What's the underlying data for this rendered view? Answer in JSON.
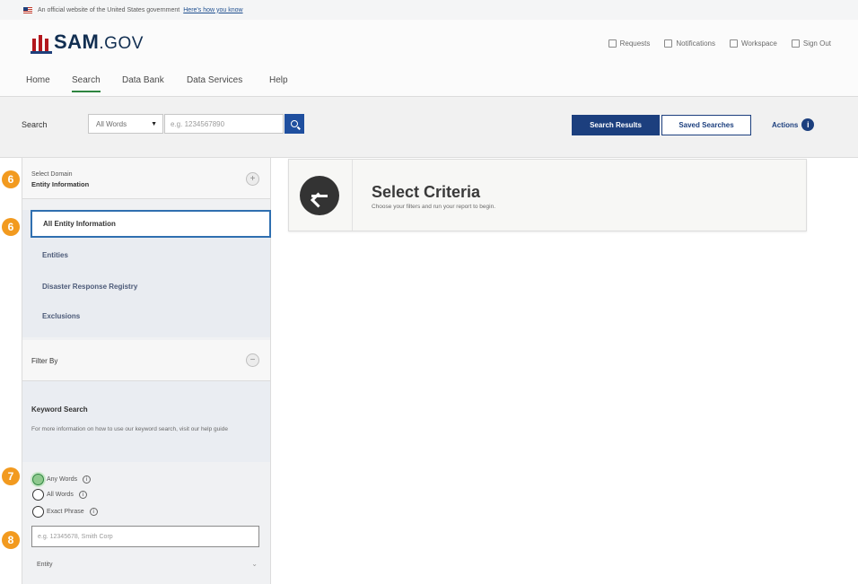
{
  "gov_banner": {
    "text": "An official website of the United States government",
    "link": "Here's how you know"
  },
  "logo": {
    "brand": "SAM",
    "suffix": ".GOV"
  },
  "header_links": [
    "Requests",
    "Notifications",
    "Workspace",
    "Sign Out"
  ],
  "nav": [
    "Home",
    "Search",
    "Data Bank",
    "Data Services",
    "Help"
  ],
  "nav_active": "Search",
  "search": {
    "label": "Search",
    "scope_value": "All Words",
    "placeholder": "e.g. 1234567890",
    "results_button": "Search Results",
    "saved_button": "Saved Searches",
    "actions_label": "Actions"
  },
  "sidebar": {
    "domain_label": "Select Domain",
    "domain_value": "Entity Information",
    "domain_items": [
      "All Entity Information",
      "Entities",
      "Disaster Response Registry",
      "Exclusions"
    ],
    "selected_item": "All Entity Information",
    "filter_label": "Filter By",
    "keyword_title": "Keyword Search",
    "keyword_help": "For more information on how to use our keyword search, visit our help guide",
    "radio_options": [
      "Any Words",
      "All Words",
      "Exact Phrase"
    ],
    "radio_selected": "Any Words",
    "keyword_placeholder": "e.g. 12345678, Smith Corp",
    "entity_label": "Entity"
  },
  "badges": [
    "6",
    "6",
    "7",
    "8"
  ],
  "criteria": {
    "title": "Select Criteria",
    "subtitle": "Choose your filters and run your report to begin."
  },
  "colors": {
    "primary": "#1c3f7e",
    "badge": "#f29a1f",
    "selected_radio": "#2e8540",
    "nav_active_underline": "#2e8540"
  }
}
